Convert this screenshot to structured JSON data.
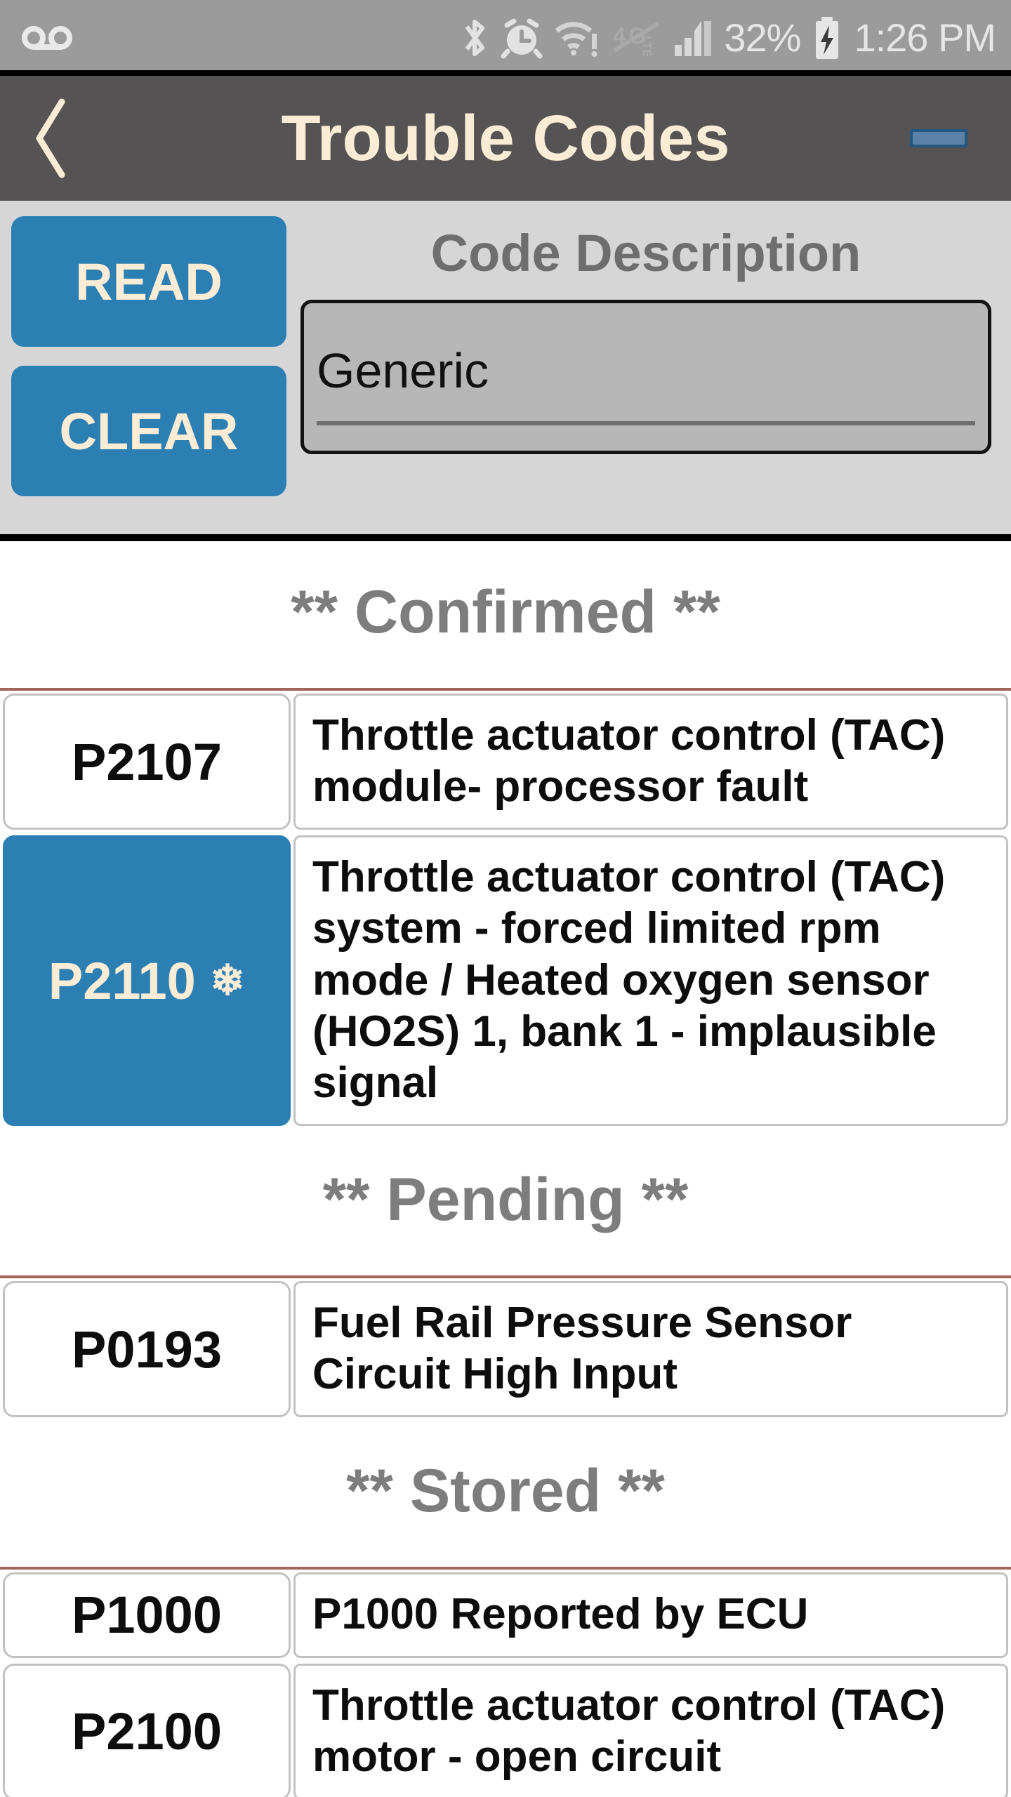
{
  "statusbar": {
    "left_icons": [
      "voicemail-icon"
    ],
    "right_icons": [
      "bluetooth-icon",
      "alarm-clock-icon",
      "wifi-alert-icon",
      "lte-off-icon",
      "cell-signal-icon"
    ],
    "battery_percent": "32%",
    "battery_icon": "battery-charging-icon",
    "time": "1:26 PM"
  },
  "titlebar": {
    "back_icon": "back-chevron-icon",
    "title": "Trouble Codes",
    "minimize_icon": "minimize-button",
    "bg_color": "#555353",
    "title_color": "#fbecd5"
  },
  "controls": {
    "read_label": "READ",
    "clear_label": "CLEAR",
    "description_label": "Code Description",
    "spinner_value": "Generic",
    "accent_color": "#2b7fb3",
    "button_text_color": "#fbecd5",
    "panel_bg": "#d6d6d6"
  },
  "sections": [
    {
      "heading": "** Confirmed **",
      "rows": [
        {
          "code": "P2107",
          "description": "Throttle actuator control (TAC) module- processor fault",
          "selected": false,
          "freeze_frame": false
        },
        {
          "code": "P2110",
          "description": "Throttle actuator control (TAC) system - forced limited rpm mode / Heated oxygen sensor (HO2S) 1, bank 1 - implausible signal",
          "selected": true,
          "freeze_frame": true,
          "freeze_frame_icon": "snowflake-icon"
        }
      ]
    },
    {
      "heading": "** Pending **",
      "rows": [
        {
          "code": "P0193",
          "description": "Fuel Rail Pressure Sensor Circuit High Input",
          "selected": false,
          "freeze_frame": false
        }
      ]
    },
    {
      "heading": "** Stored **",
      "rows": [
        {
          "code": "P1000",
          "description": "P1000 Reported by ECU",
          "selected": false,
          "freeze_frame": false
        },
        {
          "code": "P2100",
          "description": "Throttle actuator control (TAC) motor - open circuit",
          "selected": false,
          "freeze_frame": false
        }
      ]
    }
  ]
}
